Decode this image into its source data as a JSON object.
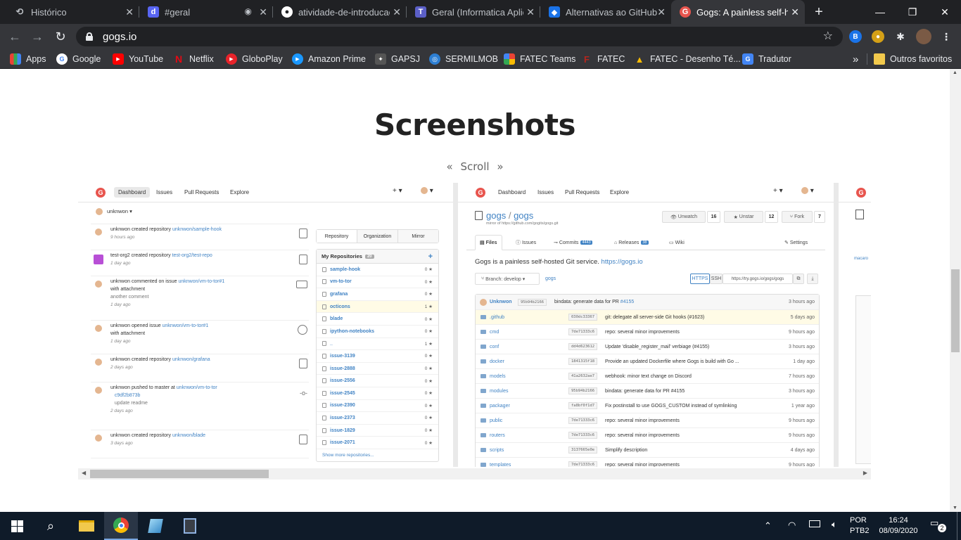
{
  "browser": {
    "tabs": [
      {
        "title": "Histórico",
        "icon": "history-icon",
        "active": false
      },
      {
        "title": "#geral",
        "icon": "discord-icon",
        "active": false
      },
      {
        "title": "atividade-de-introducao",
        "icon": "github-icon",
        "active": false
      },
      {
        "title": "Geral (Informatica Aplic",
        "icon": "teams-icon",
        "active": false
      },
      {
        "title": "Alternativas ao GitHub",
        "icon": "cube-icon",
        "active": false
      },
      {
        "title": "Gogs: A painless self-ho",
        "icon": "gogs-icon",
        "active": true
      }
    ],
    "new_tab": "+",
    "window": {
      "minimize": "—",
      "maximize": "❐",
      "close": "✕"
    },
    "url": "gogs.io",
    "bookmarks": [
      {
        "label": "Apps",
        "icon": "apps-icon"
      },
      {
        "label": "Google",
        "icon": "google-icon"
      },
      {
        "label": "YouTube",
        "icon": "youtube-icon"
      },
      {
        "label": "Netflix",
        "icon": "netflix-icon"
      },
      {
        "label": "GloboPlay",
        "icon": "globoplay-icon"
      },
      {
        "label": "Amazon Prime",
        "icon": "amazon-prime-icon"
      },
      {
        "label": "GAPSJ",
        "icon": "gapsj-icon"
      },
      {
        "label": "SERMILMOB",
        "icon": "sermilmob-icon"
      },
      {
        "label": "FATEC Teams",
        "icon": "fatec-teams-icon"
      },
      {
        "label": "FATEC",
        "icon": "fatec-icon"
      },
      {
        "label": "FATEC - Desenho Té...",
        "icon": "drive-icon"
      },
      {
        "label": "Tradutor",
        "icon": "translate-icon"
      }
    ],
    "bookmarks_more": "»",
    "other_bookmarks": "Outros favoritos"
  },
  "page": {
    "title": "Screenshots",
    "scroll_hint_left": "«",
    "scroll_hint": "Scroll",
    "scroll_hint_right": "»"
  },
  "shot1": {
    "nav": [
      "Dashboard",
      "Issues",
      "Pull Requests",
      "Explore"
    ],
    "user": "unknwon ▾",
    "feed": [
      {
        "pre": "unknwon created repository ",
        "link": "unknwon/sample-hook",
        "extra": "",
        "extra2": "",
        "time": "9 hours ago"
      },
      {
        "pre": "test-org2 created repository ",
        "link": "test-org2/test-repo",
        "extra": "",
        "extra2": "",
        "time": "1 day ago"
      },
      {
        "pre": "unknwon commented on issue ",
        "link": "unknwon/vm-to-tor#1",
        "extra": "with attachment",
        "extra2": "another comment",
        "time": "1 day ago"
      },
      {
        "pre": "unknwon opened issue ",
        "link": "unknwon/vm-to-tor#1",
        "extra": "with attachment",
        "extra2": "",
        "time": "1 day ago"
      },
      {
        "pre": "unknwon created repository ",
        "link": "unknwon/grafana",
        "extra": "",
        "extra2": "",
        "time": "2 days ago"
      },
      {
        "pre": "unknwon pushed to master at ",
        "link": "unknwon/vm-to-tor",
        "extra": "c9df2b873b",
        "extra2": "update readme",
        "time": "2 days ago"
      },
      {
        "pre": "unknwon created repository ",
        "link": "unknwon/blade",
        "extra": "",
        "extra2": "",
        "time": "3 days ago"
      }
    ],
    "tabs": [
      "Repository",
      "Organization",
      "Mirror"
    ],
    "repos_header": "My Repositories",
    "repos_count": "20",
    "repos_plus": "+",
    "repos": [
      {
        "name": "sample-hook",
        "stars": "0 ★"
      },
      {
        "name": "vm-to-tor",
        "stars": "0 ★"
      },
      {
        "name": "grafana",
        "stars": "0 ★"
      },
      {
        "name": "octicons",
        "stars": "1 ★"
      },
      {
        "name": "blade",
        "stars": "0 ★"
      },
      {
        "name": "ipython-notebooks",
        "stars": "0 ★"
      },
      {
        "name": "_",
        "stars": "1 ★"
      },
      {
        "name": "issue-3139",
        "stars": "0 ★"
      },
      {
        "name": "issue-2888",
        "stars": "0 ★"
      },
      {
        "name": "issue-2556",
        "stars": "0 ★"
      },
      {
        "name": "issue-2545",
        "stars": "0 ★"
      },
      {
        "name": "issue-2390",
        "stars": "0 ★"
      },
      {
        "name": "issue-2373",
        "stars": "0 ★"
      },
      {
        "name": "issue-1829",
        "stars": "0 ★"
      },
      {
        "name": "issue-2071",
        "stars": "0 ★"
      }
    ],
    "show_more": "Show more repositories..."
  },
  "shot2": {
    "nav": [
      "Dashboard",
      "Issues",
      "Pull Requests",
      "Explore"
    ],
    "repo_owner": "gogs",
    "repo_sep": "/",
    "repo_name": "gogs",
    "mirror_of": "mirror of https://github.com/gogits/gogs.git",
    "unwatch": "Unwatch",
    "watch_count": "16",
    "unstar": "Unstar",
    "star_count": "12",
    "fork": "Fork",
    "fork_count": "7",
    "tabs": [
      {
        "label": "Files",
        "badge": ""
      },
      {
        "label": "Issues",
        "badge": ""
      },
      {
        "label": "Commits",
        "badge": "4443"
      },
      {
        "label": "Releases",
        "badge": "38"
      },
      {
        "label": "Wiki",
        "badge": ""
      },
      {
        "label": "Settings",
        "badge": ""
      }
    ],
    "description": "Gogs is a painless self-hosted Git service. ",
    "description_link": "https://gogs.io",
    "branch": "Branch: develop ▾",
    "path": "gogs",
    "https": "HTTPS",
    "ssh": "SSH",
    "clone_url": "https://try.gogs.io/gogs/gogs",
    "last_commit": {
      "author": "Unknwon",
      "sha": "95b94b2166",
      "msg": "bindata: generate data for PR ",
      "ref": "#4155",
      "time": "3 hours ago"
    },
    "files": [
      {
        "name": ".github",
        "sha": "030dc33367",
        "msg": "git: delegate all server-side Git hooks (#1623)",
        "time": "5 days ago",
        "hl": true
      },
      {
        "name": "cmd",
        "sha": "7de71333c6",
        "msg": "repo: several minor improvements",
        "time": "9 hours ago",
        "hl": false
      },
      {
        "name": "conf",
        "sha": "dd4d623612",
        "msg": "Update 'disable_register_mail' verbiage (#4155)",
        "time": "3 hours ago",
        "hl": false
      },
      {
        "name": "docker",
        "sha": "1841315f18",
        "msg": "Provide an updated Dockerfile where Gogs is build with Go ...",
        "time": "1 day ago",
        "hl": false
      },
      {
        "name": "models",
        "sha": "41a2632ae7",
        "msg": "webhook: minor text change on Discord",
        "time": "7 hours ago",
        "hl": false
      },
      {
        "name": "modules",
        "sha": "95b94b2166",
        "msg": "bindata: generate data for PR #4155",
        "time": "3 hours ago",
        "hl": false
      },
      {
        "name": "packager",
        "sha": "fa8bf0f1d7",
        "msg": "Fix postinstall to use GOGS_CUSTOM instead of symlinking",
        "time": "1 year ago",
        "hl": false
      },
      {
        "name": "public",
        "sha": "7de71333c6",
        "msg": "repo: several minor improvements",
        "time": "9 hours ago",
        "hl": false
      },
      {
        "name": "routers",
        "sha": "7de71333c6",
        "msg": "repo: several minor improvements",
        "time": "9 hours ago",
        "hl": false
      },
      {
        "name": "scripts",
        "sha": "3137665e0e",
        "msg": "Simplify description",
        "time": "4 days ago",
        "hl": false
      },
      {
        "name": "templates",
        "sha": "7de71333c6",
        "msg": "repo: several minor improvements",
        "time": "9 hours ago",
        "hl": false
      }
    ]
  },
  "shot3": {
    "text": "macaro"
  },
  "taskbar": {
    "language": "POR",
    "layout": "PTB2",
    "time": "16:24",
    "date": "08/09/2020",
    "notifications": "2"
  },
  "colors": {
    "gogs_red": "#e8554e",
    "link_blue": "#4183c4",
    "chrome_dark": "#202124",
    "taskbar": "#0f1b29"
  }
}
